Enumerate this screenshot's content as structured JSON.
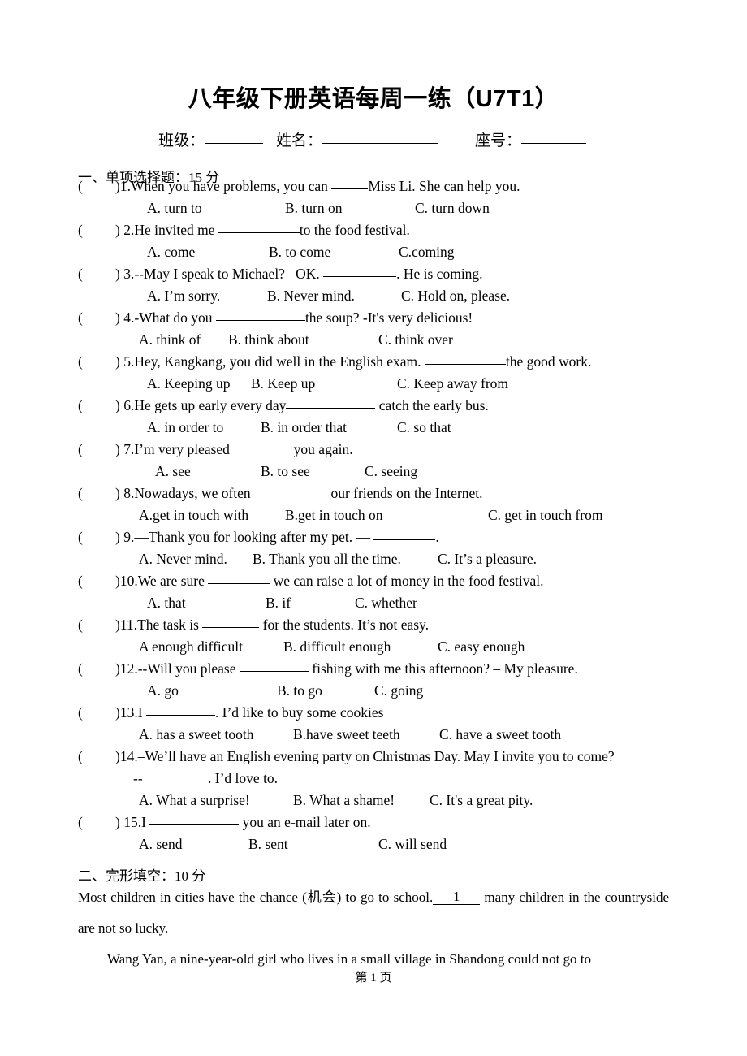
{
  "document": {
    "title": "八年级下册英语每周一练（U7T1）",
    "footer": "第 1 页"
  },
  "info_line": {
    "class_label": "班级：",
    "name_label": "姓名：",
    "seat_label": "座号："
  },
  "sections": [
    {
      "heading": "一、单项选择题：15 分"
    },
    {
      "heading": "二、完形填空：10 分"
    }
  ],
  "questions": [
    {
      "paren": "(",
      "close": ")1.",
      "stem_before": "When you have problems, you can ",
      "stem_after": "Miss Li. She can help you.",
      "options": [
        "A. turn to",
        "B. turn on",
        "C. turn down"
      ]
    },
    {
      "paren": "(",
      "close": ") 2.",
      "stem_before": "He invited me ",
      "stem_after": "to the food festival.",
      "options": [
        "A. come",
        "B. to come",
        "C.coming"
      ]
    },
    {
      "paren": "(",
      "close": ") 3.",
      "stem_before": "--May I speak to Michael?     –OK. ",
      "stem_after": ". He is coming.",
      "options": [
        "A. I’m sorry.",
        "B. Never mind.",
        "C. Hold on, please."
      ]
    },
    {
      "paren": "(",
      "close": ") 4.",
      "stem_before": "-What do you  ",
      "stem_after": "the soup? -It's very delicious!",
      "options": [
        "A. think of",
        "B. think about",
        "C. think over"
      ]
    },
    {
      "paren": "(",
      "close": ") 5.",
      "stem_before": "Hey, Kangkang, you did well in the English exam. ",
      "stem_after": "the good work.",
      "options": [
        "A. Keeping up",
        "B. Keep up",
        "C. Keep away from"
      ]
    },
    {
      "paren": "(",
      "close": ") 6.",
      "stem_before": "He gets up early every day",
      "stem_after": " catch the early bus.",
      "options": [
        "A. in order to",
        "B. in order that",
        "C. so that"
      ]
    },
    {
      "paren": "(",
      "close": ") 7.",
      "stem_before": "I’m very pleased ",
      "stem_after": " you again.",
      "options": [
        "A. see",
        "B. to see",
        "C. seeing"
      ]
    },
    {
      "paren": "(",
      "close": ") 8.",
      "stem_before": "Nowadays, we often ",
      "stem_after": " our friends on the Internet.",
      "options": [
        "A.get in touch with",
        "B.get in touch on",
        "C. get in touch from"
      ]
    },
    {
      "paren": "(",
      "close": ") 9.",
      "stem_before": "—Thank you for looking after my pet.        — ",
      "stem_after": ".",
      "options": [
        "A. Never mind.",
        "B. Thank you all the time.",
        "C. It’s a pleasure."
      ]
    },
    {
      "paren": "(",
      "close": ")10.",
      "stem_before": "We are sure ",
      "stem_after": " we can raise a lot of money in the food festival.",
      "options": [
        "A. that",
        "B. if",
        "C. whether"
      ]
    },
    {
      "paren": "(",
      "close": ")11.",
      "stem_before": "The task is ",
      "stem_after": " for the students. It’s not easy.",
      "options": [
        "A enough difficult",
        "B. difficult enough",
        "C. easy enough"
      ]
    },
    {
      "paren": "(",
      "close": ")12.",
      "stem_before": "--Will you please ",
      "stem_after": " fishing with me this afternoon? – My pleasure.",
      "options": [
        "A. go",
        "B. to go",
        "C. going"
      ]
    },
    {
      "paren": "(",
      "close": ")13.",
      "stem_before": "I ",
      "stem_after": ". I’d like to buy some cookies",
      "options": [
        "A. has a sweet tooth",
        "B.have sweet teeth",
        "C. have a sweet tooth"
      ]
    },
    {
      "paren": "(",
      "close": ")14.",
      "stem_before": "–We’ll have an English evening party on Christmas Day. May I invite you to come?",
      "stem_after": "",
      "continuation_before": "-- ",
      "continuation_after": ". I’d love to.",
      "options": [
        "A. What a surprise!",
        "B. What a shame!",
        "C. It's a great pity."
      ]
    },
    {
      "paren": "(",
      "close": ") 15.",
      "stem_before": "I ",
      "stem_after": " you an e-mail later on.",
      "options": [
        "A. send",
        "B. sent",
        "C. will send"
      ]
    }
  ],
  "cloze": {
    "para1_a": "Most children in cities have the chance (机会) to go to school.",
    "para1_blank": "1",
    "para1_b": " many children in the countryside are not so lucky.",
    "para2": "Wang Yan, a nine-year-old girl who lives in a small village in Shandong could not go to"
  }
}
